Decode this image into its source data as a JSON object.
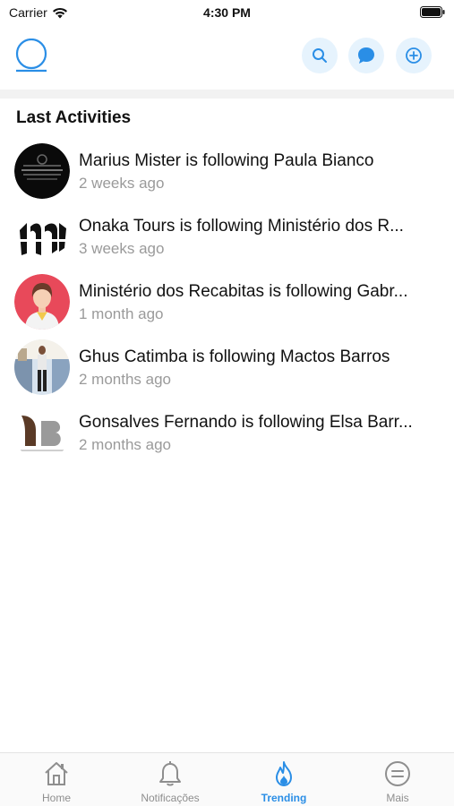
{
  "status": {
    "carrier": "Carrier",
    "time": "4:30 PM"
  },
  "header": {
    "icons": [
      "profile-ring-icon",
      "search-icon",
      "chat-bubble-icon",
      "add-circle-icon"
    ],
    "accent": "#2a8ee6",
    "button_bg": "#e6f3fd"
  },
  "section_title": "Last Activities",
  "activities": [
    {
      "text": "Marius Mister is following Paula Bianco",
      "time": "2 weeks ago"
    },
    {
      "text": "Onaka Tours is following Ministério dos R...",
      "time": "3 weeks ago"
    },
    {
      "text": "Ministério dos Recabitas is following Gabr...",
      "time": "1 month ago"
    },
    {
      "text": "Ghus Catimba is following Mactos Barros",
      "time": "2 months ago"
    },
    {
      "text": "Gonsalves Fernando is following Elsa Barr...",
      "time": "2 months ago"
    }
  ],
  "tabs": [
    {
      "label": "Home",
      "icon": "home-icon",
      "active": false
    },
    {
      "label": "Notificações",
      "icon": "bell-icon",
      "active": false
    },
    {
      "label": "Trending",
      "icon": "flame-icon",
      "active": true
    },
    {
      "label": "Mais",
      "icon": "menu-circle-icon",
      "active": false
    }
  ]
}
